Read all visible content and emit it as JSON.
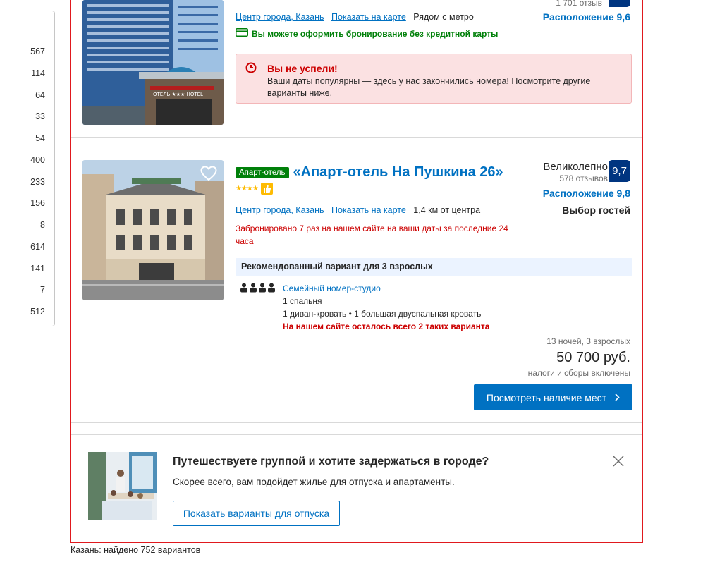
{
  "sidebar": {
    "counts": [
      "567",
      "114",
      "64",
      "33",
      "54",
      "400",
      "233",
      "156",
      "8",
      "614",
      "141",
      "7",
      "512"
    ]
  },
  "hotel1": {
    "reviews": "1 701 отзыв",
    "location_score": "Расположение 9,6",
    "city_link": "Центр города, Казань",
    "map_link": "Показать на карте",
    "distance": "Рядом с метро",
    "no_card": "Вы можете оформить бронирование без кредитной карты",
    "alert_title": "Вы не успели!",
    "alert_text": "Ваши даты популярны — здесь у нас закончились номера! Посмотрите другие варианты ниже.",
    "image_sign": "ОТЕЛЬ ★★★ HOTEL"
  },
  "hotel2": {
    "type_badge": "Апарт-отель",
    "name": "«Апарт-отель На Пушкина 26»",
    "rating_word": "Великолепно",
    "reviews": "578 отзывов",
    "score": "9,7",
    "location_score": "Расположение 9,8",
    "guests_choice": "Выбор гостей",
    "city_link": "Центр города, Казань",
    "map_link": "Показать на карте",
    "distance": "1,4 км от центра",
    "booked_note": "Забронировано 7 раз на нашем сайте на ваши даты за последние 24 часа",
    "recommended": "Рекомендованный вариант для 3 взрослых",
    "room_name": "Семейный номер-студио",
    "bedrooms": "1 спальня",
    "beds": "1 диван-кровать • 1 большая двуспальная кровать",
    "scarcity": "На нашем сайте осталось всего 2 таких варианта",
    "nights": "13 ночей, 3 взрослых",
    "price": "50 700 руб.",
    "taxes": "налоги и сборы включены",
    "cta": "Посмотреть наличие мест",
    "stars": "★★★★"
  },
  "promo": {
    "title": "Путешествуете группой и хотите задержаться в городе?",
    "text": "Скорее всего, вам подойдет жилье для отпуска и апартаменты.",
    "button": "Показать варианты для отпуска"
  },
  "footer": {
    "found": "Казань: найдено 752 вариантов"
  },
  "colors": {
    "brand_blue": "#003580",
    "link_blue": "#0071c2",
    "alert_red": "#cc0000",
    "green": "#008009"
  },
  "icons": [
    "heart-icon",
    "clock-icon",
    "credit-card-icon",
    "thumbs-up-icon",
    "person-icon",
    "chevron-right-icon",
    "close-icon"
  ]
}
